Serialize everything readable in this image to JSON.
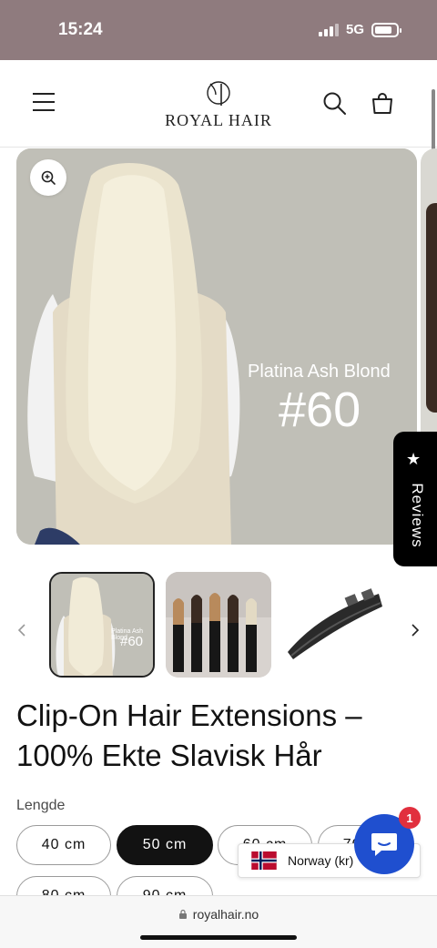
{
  "status_bar": {
    "time": "15:24",
    "network": "5G"
  },
  "header": {
    "logo_text": "ROYAL HAIR"
  },
  "gallery": {
    "overlay_label": "Platina Ash Blond",
    "overlay_code": "#60"
  },
  "thumbnails": [
    {
      "label": "Platina Ash Blond",
      "code": "#60"
    },
    {
      "label": ""
    },
    {
      "label": ""
    }
  ],
  "reviews_tab": {
    "label": "Reviews"
  },
  "product": {
    "title": "Clip-On Hair Extensions – 100% Ekte Slavisk Hår",
    "length_label": "Lengde",
    "lengths": [
      "40 cm",
      "50 cm",
      "60 cm",
      "70 cm",
      "80 cm",
      "90 cm"
    ],
    "selected_length": "50 cm"
  },
  "chat": {
    "badge_count": "1"
  },
  "region": {
    "country": "Norway (kr)"
  },
  "browser": {
    "url": "royalhair.no"
  },
  "colors": {
    "status_bar": "#8f7b7e",
    "chat_button": "#1f4fcf",
    "badge": "#e1303e",
    "selected_pill": "#121212"
  }
}
